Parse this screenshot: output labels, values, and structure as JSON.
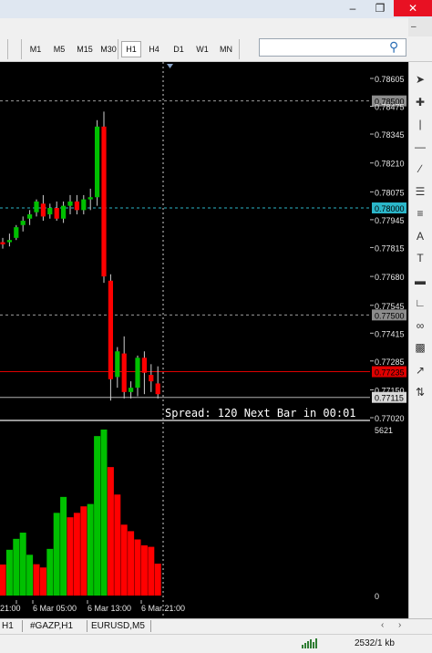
{
  "window": {
    "minimize_icon": "minimize-icon",
    "restore_icon": "restore-icon",
    "close_icon": "close-icon",
    "close_color": "#e81123"
  },
  "toolbar": {
    "timeframes": [
      "M1",
      "M5",
      "M15",
      "M30",
      "H1",
      "H4",
      "D1",
      "W1",
      "MN"
    ],
    "active_timeframe": "H1",
    "search_value": ""
  },
  "chart": {
    "background": "#000000",
    "bull_color": "#00c000",
    "bear_color": "#ff0000",
    "price_labels": [
      "0.78605",
      "0.78500",
      "0.78475",
      "0.78345",
      "0.78210",
      "0.78075",
      "0.78000",
      "0.77945",
      "0.77815",
      "0.77680",
      "0.77545",
      "0.77500",
      "0.77415",
      "0.77285",
      "0.77235",
      "0.77150",
      "0.77115",
      "0.77020"
    ],
    "highlight_labels": {
      "level_upper": "0.78500",
      "level_cyan": "0.78000",
      "level_mid": "0.77500",
      "bid": "0.77235",
      "ask": "0.77115"
    },
    "info_text": "Spread: 120 Next Bar in 00:01",
    "volume_max_label": "5621",
    "volume_zero_label": "0",
    "time_labels": [
      "21:00",
      "6 Mar 05:00",
      "6 Mar 13:00",
      "6 Mar 21:00"
    ],
    "candles": [
      {
        "o": 0.7784,
        "h": 0.7786,
        "l": 0.7781,
        "c": 0.7783
      },
      {
        "o": 0.7784,
        "h": 0.7788,
        "l": 0.7782,
        "c": 0.7785
      },
      {
        "o": 0.7786,
        "h": 0.7792,
        "l": 0.7785,
        "c": 0.7791
      },
      {
        "o": 0.7792,
        "h": 0.7796,
        "l": 0.7789,
        "c": 0.7794
      },
      {
        "o": 0.7795,
        "h": 0.7799,
        "l": 0.7792,
        "c": 0.7797
      },
      {
        "o": 0.7798,
        "h": 0.7804,
        "l": 0.7796,
        "c": 0.7803
      },
      {
        "o": 0.7802,
        "h": 0.7806,
        "l": 0.7794,
        "c": 0.7796
      },
      {
        "o": 0.7797,
        "h": 0.7802,
        "l": 0.7795,
        "c": 0.78
      },
      {
        "o": 0.78,
        "h": 0.7803,
        "l": 0.7794,
        "c": 0.7795
      },
      {
        "o": 0.7795,
        "h": 0.7803,
        "l": 0.7793,
        "c": 0.7801
      },
      {
        "o": 0.7801,
        "h": 0.7806,
        "l": 0.7797,
        "c": 0.7803
      },
      {
        "o": 0.7803,
        "h": 0.7806,
        "l": 0.7797,
        "c": 0.7799
      },
      {
        "o": 0.7799,
        "h": 0.7806,
        "l": 0.7797,
        "c": 0.7804
      },
      {
        "o": 0.7804,
        "h": 0.7809,
        "l": 0.7799,
        "c": 0.7805
      },
      {
        "o": 0.7805,
        "h": 0.7841,
        "l": 0.7801,
        "c": 0.7838
      },
      {
        "o": 0.7838,
        "h": 0.7845,
        "l": 0.7765,
        "c": 0.7768
      },
      {
        "o": 0.7766,
        "h": 0.7769,
        "l": 0.771,
        "c": 0.772
      },
      {
        "o": 0.7721,
        "h": 0.7735,
        "l": 0.7716,
        "c": 0.7733
      },
      {
        "o": 0.7732,
        "h": 0.774,
        "l": 0.7711,
        "c": 0.7714
      },
      {
        "o": 0.7714,
        "h": 0.7719,
        "l": 0.7711,
        "c": 0.7716
      },
      {
        "o": 0.7716,
        "h": 0.7731,
        "l": 0.7712,
        "c": 0.773
      },
      {
        "o": 0.773,
        "h": 0.7733,
        "l": 0.7713,
        "c": 0.7723
      },
      {
        "o": 0.7722,
        "h": 0.7727,
        "l": 0.7714,
        "c": 0.7719
      },
      {
        "o": 0.7718,
        "h": 0.7726,
        "l": 0.7711,
        "c": 0.7713
      }
    ],
    "volume": {
      "max": 5621,
      "values": [
        {
          "v": 1050,
          "bull": false
        },
        {
          "v": 1550,
          "bull": true
        },
        {
          "v": 1920,
          "bull": true
        },
        {
          "v": 2130,
          "bull": true
        },
        {
          "v": 1380,
          "bull": true
        },
        {
          "v": 1060,
          "bull": false
        },
        {
          "v": 950,
          "bull": false
        },
        {
          "v": 1580,
          "bull": true
        },
        {
          "v": 2800,
          "bull": true
        },
        {
          "v": 3340,
          "bull": true
        },
        {
          "v": 2650,
          "bull": false
        },
        {
          "v": 2800,
          "bull": false
        },
        {
          "v": 3020,
          "bull": false
        },
        {
          "v": 3100,
          "bull": true
        },
        {
          "v": 5400,
          "bull": true
        },
        {
          "v": 5621,
          "bull": true
        },
        {
          "v": 4350,
          "bull": false
        },
        {
          "v": 3420,
          "bull": false
        },
        {
          "v": 2400,
          "bull": false
        },
        {
          "v": 2180,
          "bull": false
        },
        {
          "v": 1900,
          "bull": false
        },
        {
          "v": 1700,
          "bull": false
        },
        {
          "v": 1650,
          "bull": false
        },
        {
          "v": 1080,
          "bull": false
        }
      ]
    }
  },
  "side_tools": [
    "cursor-icon",
    "crosshair-icon",
    "vertical-line-icon",
    "horizontal-line-icon",
    "trendline-icon",
    "fibonacci-icon",
    "fibo-fan-icon",
    "text-icon",
    "text-label-icon",
    "rectangle-icon",
    "pitchfork-icon",
    "gann-fan-icon",
    "pattern-icon",
    "arrow-icon",
    "trade-levels-icon"
  ],
  "tabs": [
    "H1",
    "#GAZP,H1",
    "EURUSD,M5"
  ],
  "status": {
    "traffic": "2532/1 kb"
  }
}
